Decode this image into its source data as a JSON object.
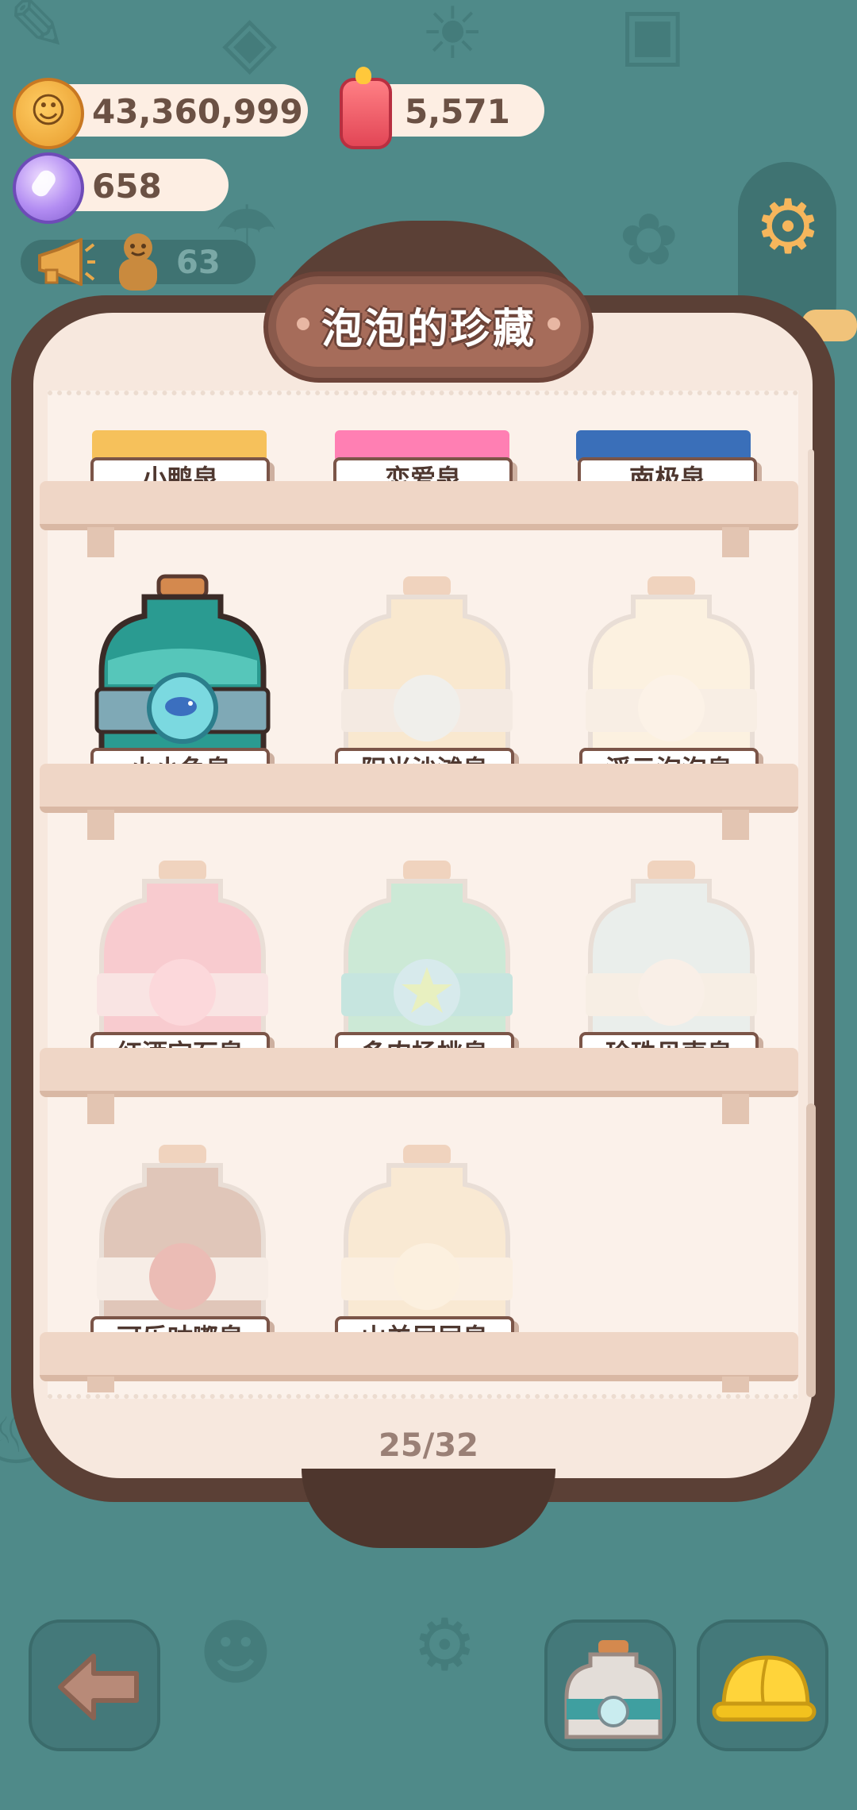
{
  "resources": {
    "cookies": "43,360,999",
    "candles": "5,571",
    "gems": "658",
    "ad_count": "63"
  },
  "panel": {
    "title": "泡泡的珍藏",
    "page_counter": "25/32"
  },
  "collection": {
    "top_row": [
      "小鸭泉",
      "恋爱泉",
      "南极泉"
    ],
    "rows": [
      [
        {
          "label": "小小鱼泉",
          "unlocked": true,
          "color": "#3fb6ad"
        },
        {
          "label": "阳光沙滩泉",
          "unlocked": false,
          "color": "#f4d28a"
        },
        {
          "label": "浮云泡泡泉",
          "unlocked": false,
          "color": "#fff2c8"
        }
      ],
      [
        {
          "label": "红酒宝石泉",
          "unlocked": false,
          "color": "#f26d8c"
        },
        {
          "label": "多肉杨桃泉",
          "unlocked": false,
          "color": "#56d6a6"
        },
        {
          "label": "珍珠贝壳泉",
          "unlocked": false,
          "color": "#bfe8f0"
        }
      ],
      [
        {
          "label": "可乐咕嘟泉",
          "unlocked": false,
          "color": "#9b5a3e"
        },
        {
          "label": "山羊屁屁泉",
          "unlocked": false,
          "color": "#f7d79a"
        }
      ]
    ]
  },
  "icons": {
    "settings": "gear-icon",
    "back": "back-arrow-icon",
    "bottle": "bottle-icon",
    "hat": "hard-hat-icon"
  }
}
